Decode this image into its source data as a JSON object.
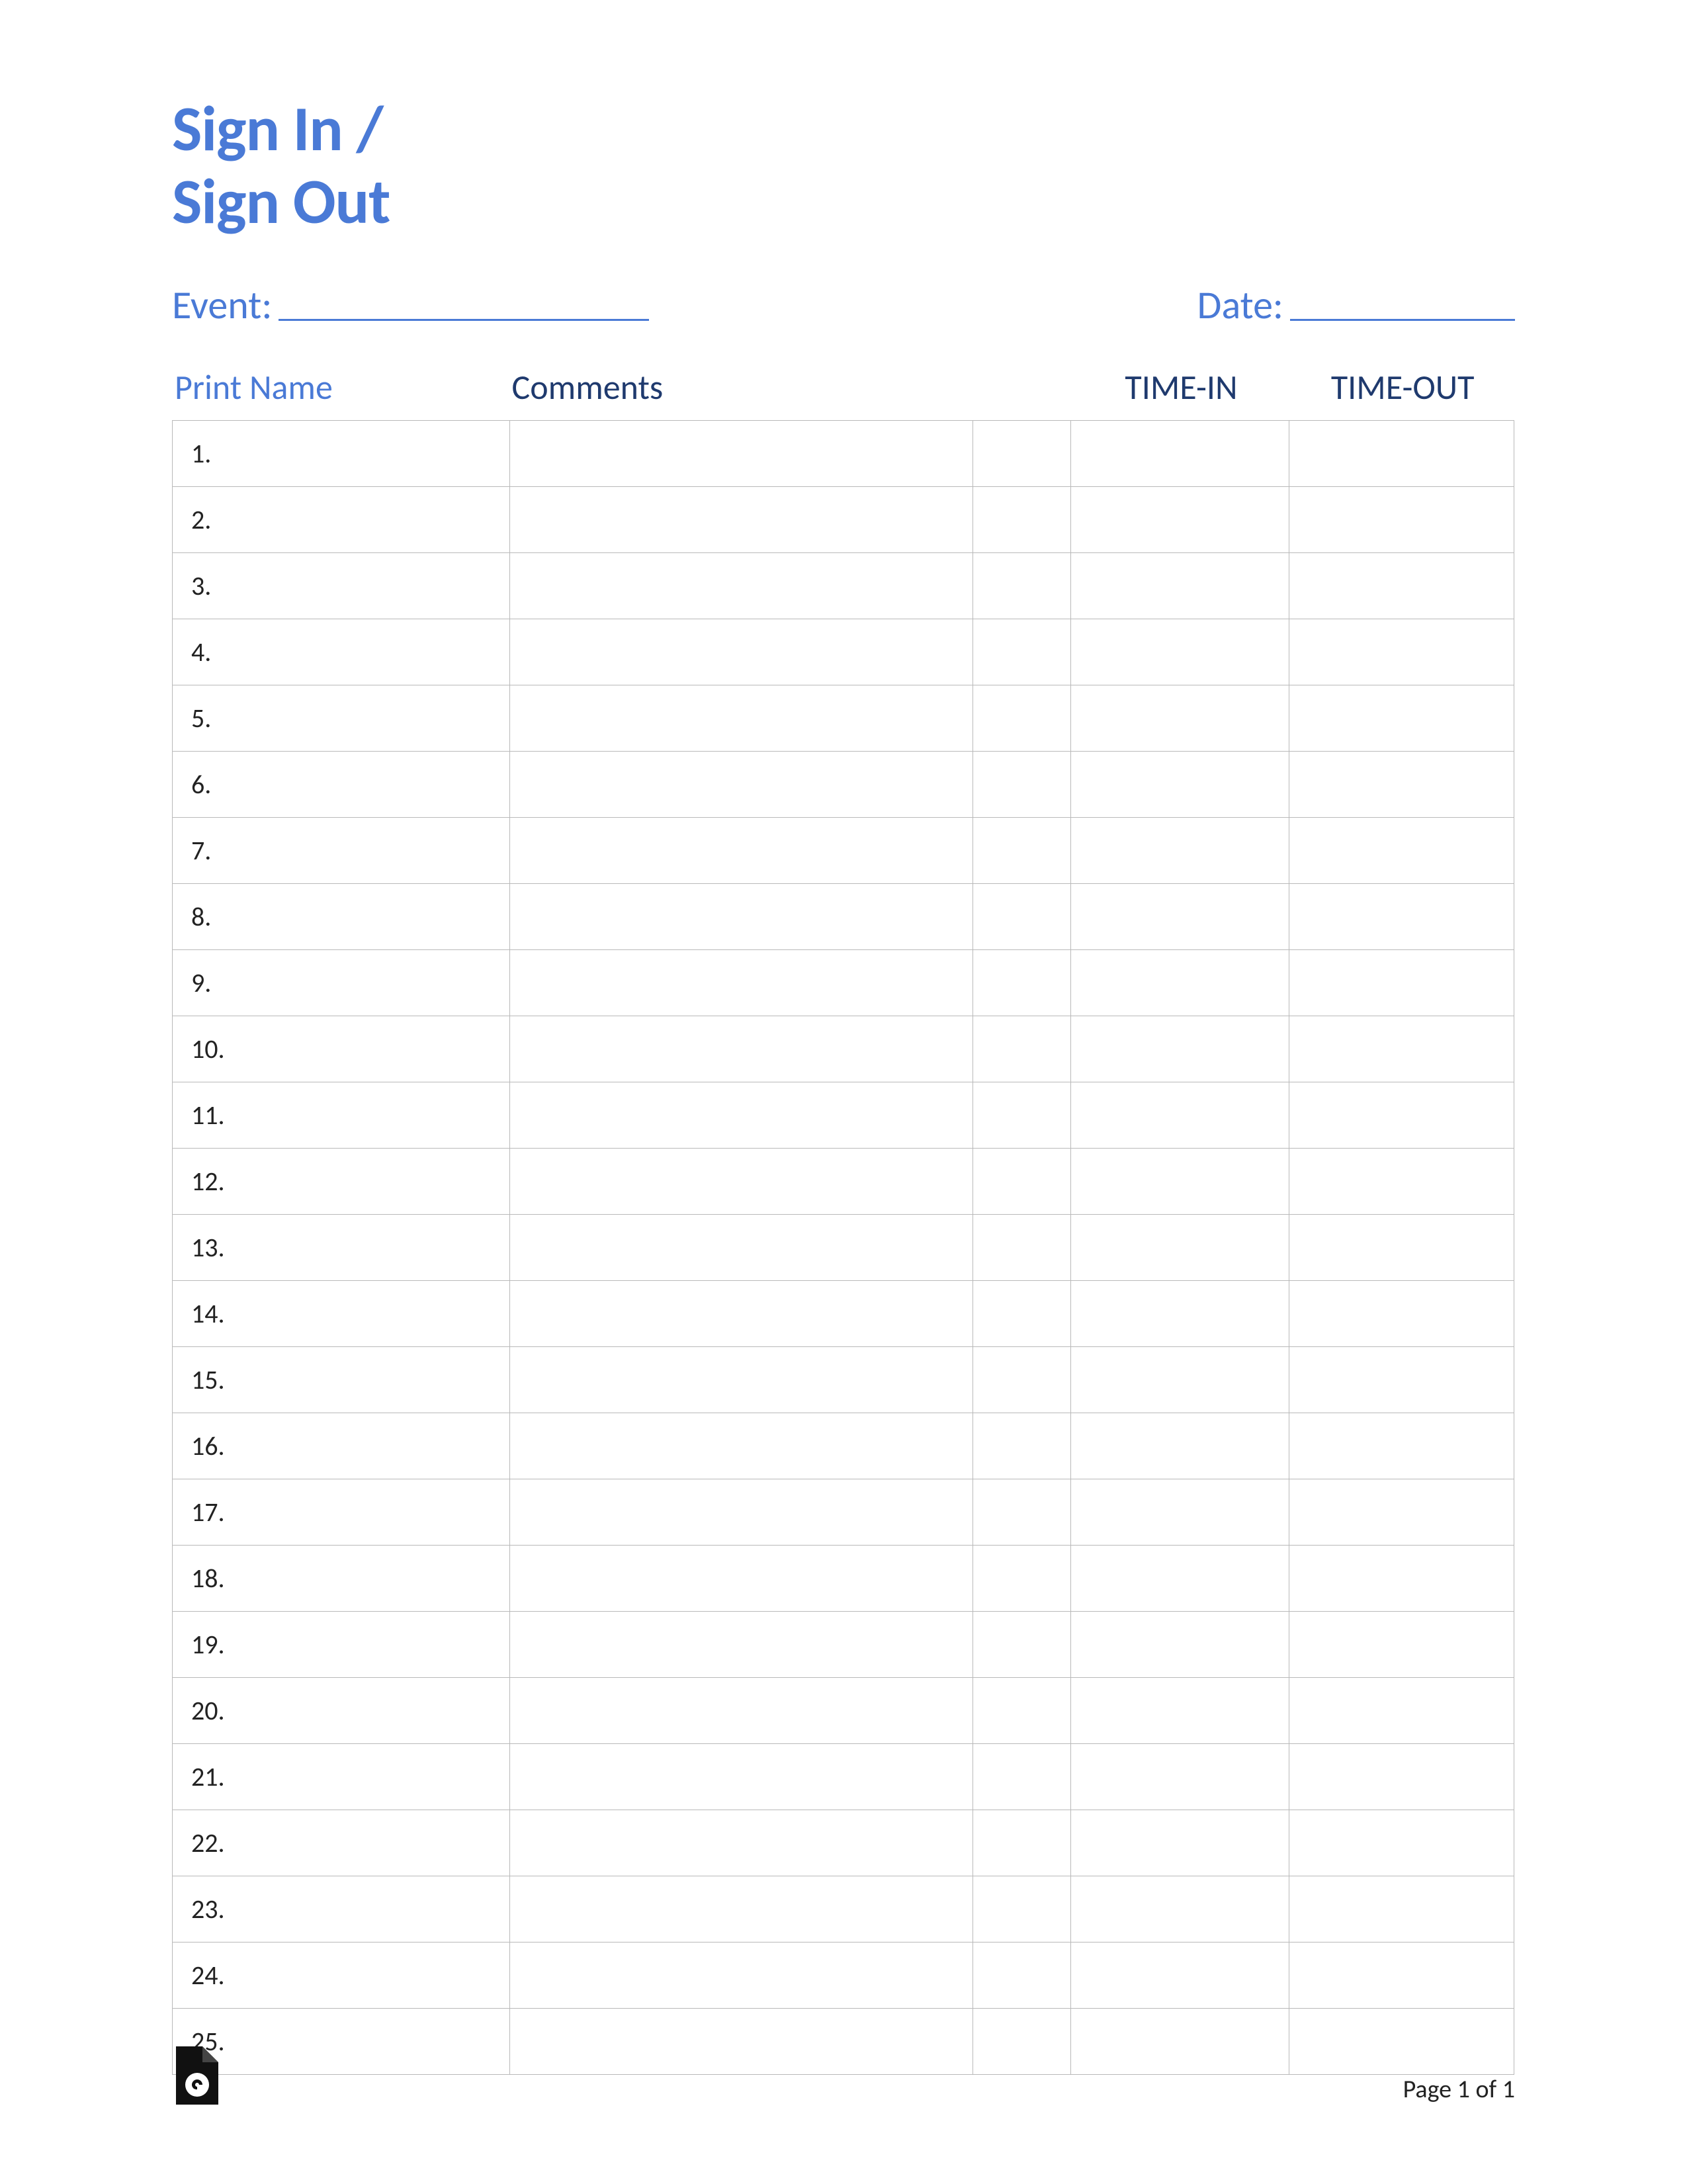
{
  "title_line1": "Sign In /",
  "title_line2": "Sign Out",
  "meta": {
    "event_label": "Event:",
    "date_label": "Date:"
  },
  "headers": {
    "print_name": "Print Name",
    "comments": "Comments",
    "time_in": "TIME-IN",
    "time_out": "TIME-OUT"
  },
  "rows": [
    {
      "num": "1.",
      "name": "",
      "comments": "",
      "time_in": "",
      "time_out": ""
    },
    {
      "num": "2.",
      "name": "",
      "comments": "",
      "time_in": "",
      "time_out": ""
    },
    {
      "num": "3.",
      "name": "",
      "comments": "",
      "time_in": "",
      "time_out": ""
    },
    {
      "num": "4.",
      "name": "",
      "comments": "",
      "time_in": "",
      "time_out": ""
    },
    {
      "num": "5.",
      "name": "",
      "comments": "",
      "time_in": "",
      "time_out": ""
    },
    {
      "num": "6.",
      "name": "",
      "comments": "",
      "time_in": "",
      "time_out": ""
    },
    {
      "num": "7.",
      "name": "",
      "comments": "",
      "time_in": "",
      "time_out": ""
    },
    {
      "num": "8.",
      "name": "",
      "comments": "",
      "time_in": "",
      "time_out": ""
    },
    {
      "num": "9.",
      "name": "",
      "comments": "",
      "time_in": "",
      "time_out": ""
    },
    {
      "num": "10.",
      "name": "",
      "comments": "",
      "time_in": "",
      "time_out": ""
    },
    {
      "num": "11.",
      "name": "",
      "comments": "",
      "time_in": "",
      "time_out": ""
    },
    {
      "num": "12.",
      "name": "",
      "comments": "",
      "time_in": "",
      "time_out": ""
    },
    {
      "num": "13.",
      "name": "",
      "comments": "",
      "time_in": "",
      "time_out": ""
    },
    {
      "num": "14.",
      "name": "",
      "comments": "",
      "time_in": "",
      "time_out": ""
    },
    {
      "num": "15.",
      "name": "",
      "comments": "",
      "time_in": "",
      "time_out": ""
    },
    {
      "num": "16.",
      "name": "",
      "comments": "",
      "time_in": "",
      "time_out": ""
    },
    {
      "num": "17.",
      "name": "",
      "comments": "",
      "time_in": "",
      "time_out": ""
    },
    {
      "num": "18.",
      "name": "",
      "comments": "",
      "time_in": "",
      "time_out": ""
    },
    {
      "num": "19.",
      "name": "",
      "comments": "",
      "time_in": "",
      "time_out": ""
    },
    {
      "num": "20.",
      "name": "",
      "comments": "",
      "time_in": "",
      "time_out": ""
    },
    {
      "num": "21.",
      "name": "",
      "comments": "",
      "time_in": "",
      "time_out": ""
    },
    {
      "num": "22.",
      "name": "",
      "comments": "",
      "time_in": "",
      "time_out": ""
    },
    {
      "num": "23.",
      "name": "",
      "comments": "",
      "time_in": "",
      "time_out": ""
    },
    {
      "num": "24.",
      "name": "",
      "comments": "",
      "time_in": "",
      "time_out": ""
    },
    {
      "num": "25.",
      "name": "",
      "comments": "",
      "time_in": "",
      "time_out": ""
    }
  ],
  "footer": {
    "page_text": "Page 1 of 1"
  }
}
